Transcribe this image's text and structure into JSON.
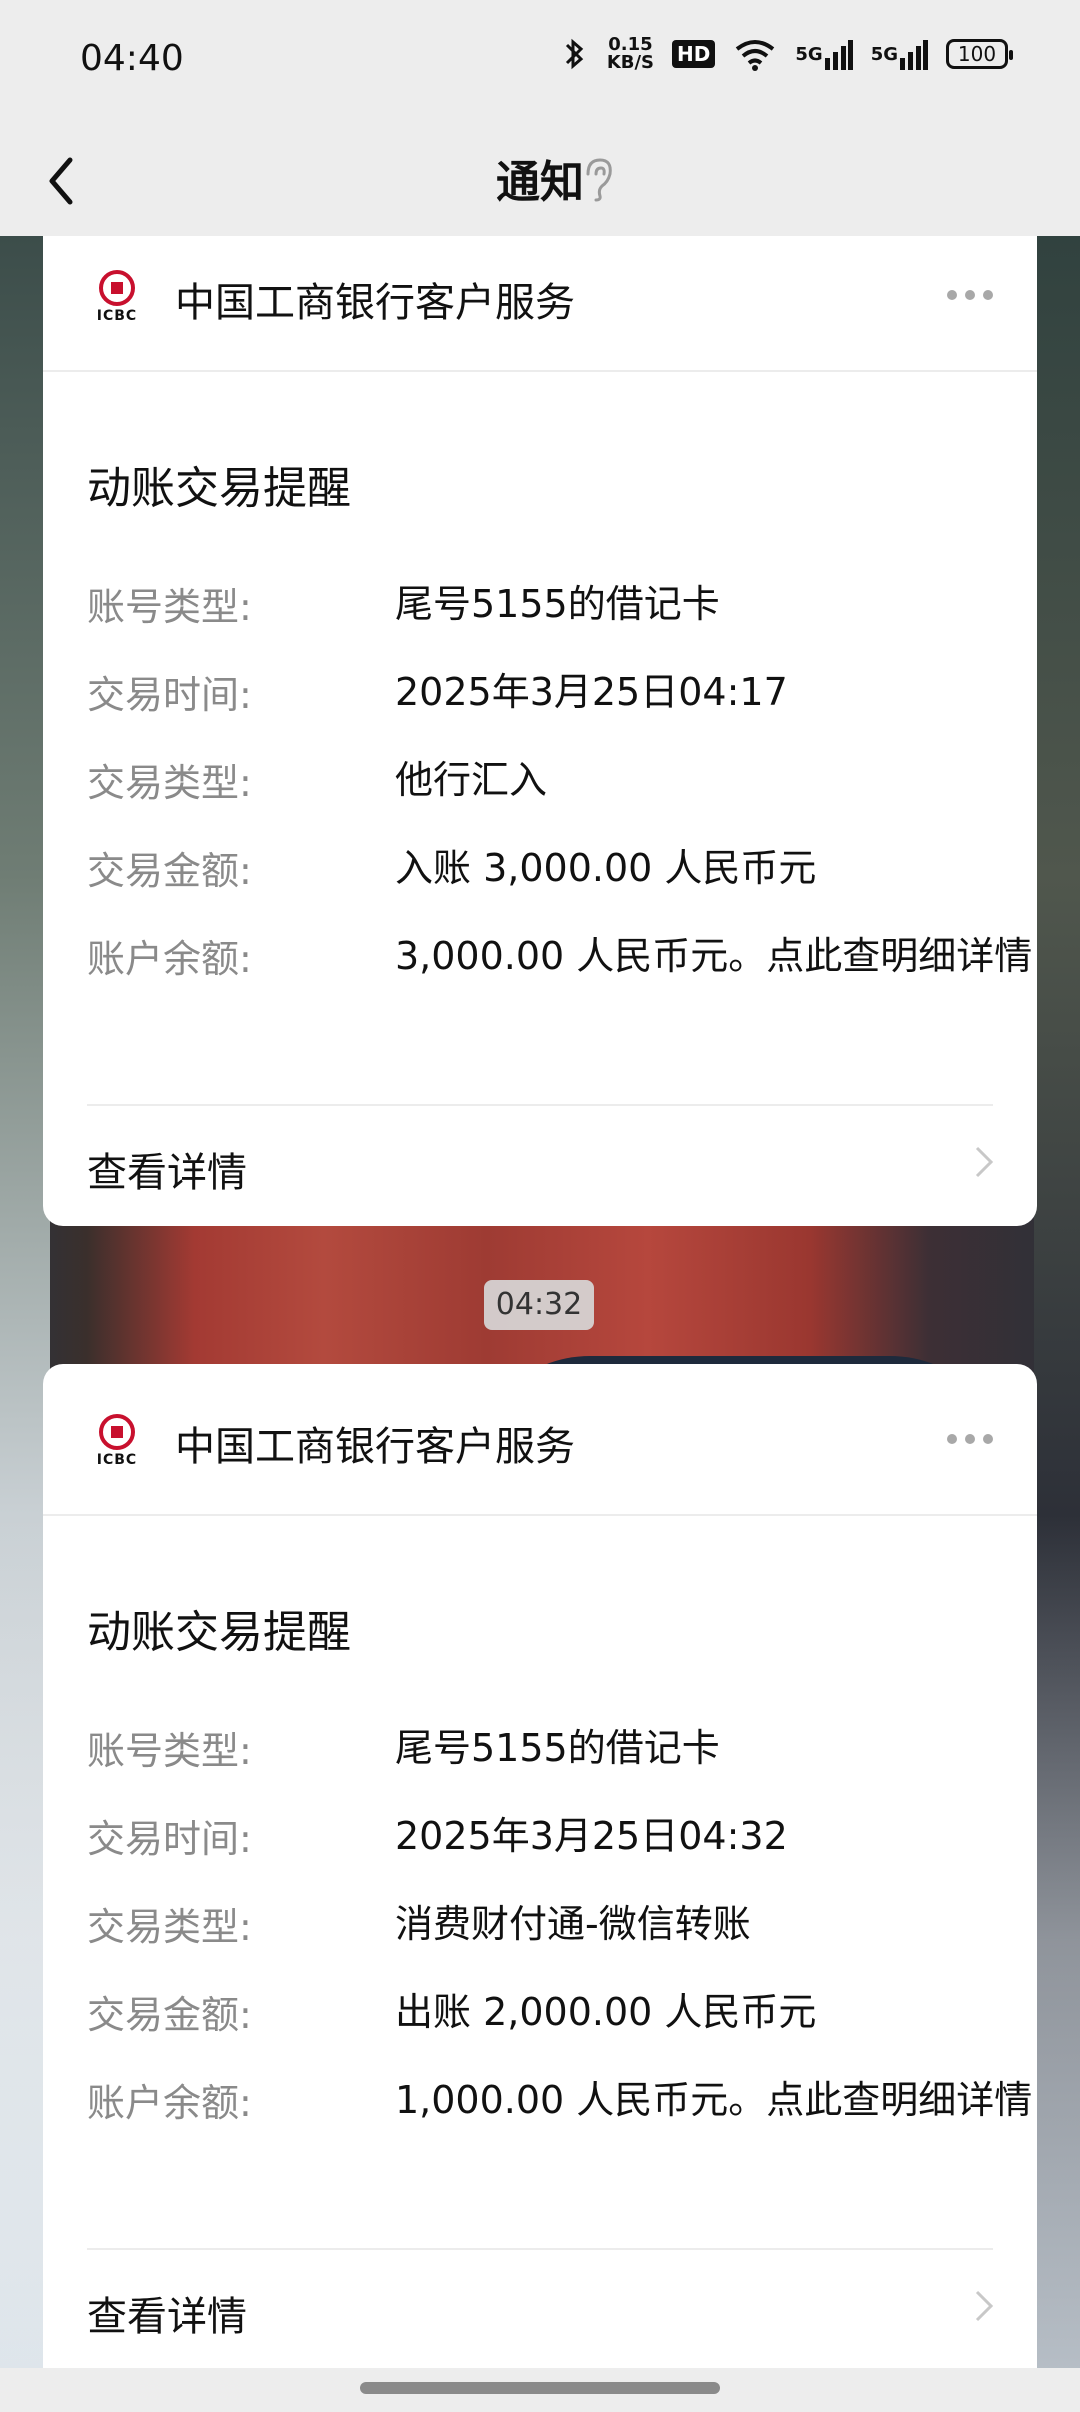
{
  "status": {
    "time": "04:40",
    "speed_value": "0.15",
    "speed_unit": "KB/S",
    "hd": "HD",
    "net1": "5G",
    "net2": "5G",
    "battery": "100"
  },
  "header": {
    "title": "通知"
  },
  "cards": [
    {
      "bank_name": "中国工商银行客户服务",
      "logo_text": "ICBC",
      "msg_title": "动账交易提醒",
      "rows": [
        {
          "label": "账号类型:",
          "value": "尾号5155的借记卡"
        },
        {
          "label": "交易时间:",
          "value": "2025年3月25日04:17"
        },
        {
          "label": "交易类型:",
          "value": "他行汇入"
        },
        {
          "label": "交易金额:",
          "value": "入账 3,000.00 人民币元"
        },
        {
          "label": "账户余额:",
          "value": "3,000.00 人民币元。点此查明细详情"
        }
      ],
      "detail_label": "查看详情"
    },
    {
      "bank_name": "中国工商银行客户服务",
      "logo_text": "ICBC",
      "msg_title": "动账交易提醒",
      "rows": [
        {
          "label": "账号类型:",
          "value": "尾号5155的借记卡"
        },
        {
          "label": "交易时间:",
          "value": "2025年3月25日04:32"
        },
        {
          "label": "交易类型:",
          "value": "消费财付通-微信转账"
        },
        {
          "label": "交易金额:",
          "value": "出账 2,000.00 人民币元"
        },
        {
          "label": "账户余额:",
          "value": "1,000.00 人民币元。点此查明细详情"
        }
      ],
      "detail_label": "查看详情"
    }
  ],
  "time_divider": "04:32",
  "icons": {
    "back": "chevron-left-icon",
    "ear": "ear-icon",
    "more": "more-dots-icon",
    "chevron": "chevron-right-icon",
    "bluetooth": "bluetooth-icon",
    "wifi": "wifi-icon",
    "signal": "signal-icon",
    "battery": "battery-icon",
    "logo": "icbc-logo-icon"
  },
  "colors": {
    "brand_red": "#c8102e",
    "background": "#ededed",
    "card": "#ffffff",
    "label_gray": "#8a8a8a"
  }
}
